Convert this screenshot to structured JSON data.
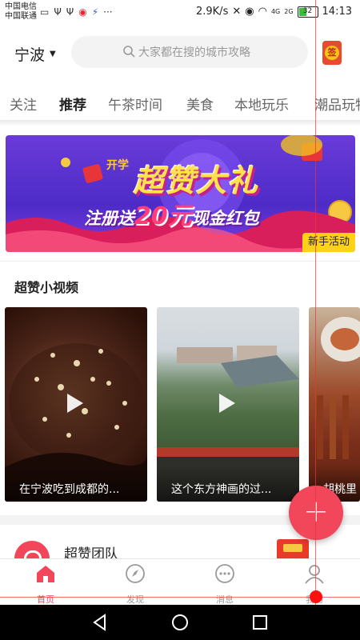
{
  "status_bar": {
    "carrier1": "中国电信",
    "carrier2": "中国联通",
    "more": "···",
    "speed": "2.9K/s",
    "signal1": "4G",
    "signal2": "2G",
    "battery": "32",
    "time": "14:13"
  },
  "header": {
    "city": "宁波",
    "search_placeholder": "大家都在搜的城市攻略",
    "checkin_label": "签"
  },
  "tabs": [
    {
      "label": "关注"
    },
    {
      "label": "推荐",
      "active": true
    },
    {
      "label": "午茶时间"
    },
    {
      "label": "美食"
    },
    {
      "label": "本地玩乐"
    },
    {
      "label": "潮品玩物"
    }
  ],
  "banner": {
    "kaixue": "开学",
    "title": "超赞大礼",
    "sub_prefix": "注册送",
    "sub_amount": "20元",
    "sub_suffix": "现金红包",
    "badge": "新手活动"
  },
  "section": {
    "title": "超赞小视频"
  },
  "videos": [
    {
      "caption": "在宁波吃到成都的..."
    },
    {
      "caption": "这个东方神画的过..."
    },
    {
      "caption": "胡桃里"
    }
  ],
  "team": {
    "name": "超赞团队"
  },
  "bottom_nav": [
    {
      "label": "首页",
      "icon": "home-icon",
      "active": true
    },
    {
      "label": "发现",
      "icon": "compass-icon"
    },
    {
      "label": "消息",
      "icon": "message-icon"
    },
    {
      "label": "我的",
      "icon": "person-icon"
    }
  ],
  "colors": {
    "accent": "#f2465a",
    "banner_purple": "#5a30cf",
    "badge_yellow": "#ffd21a"
  }
}
